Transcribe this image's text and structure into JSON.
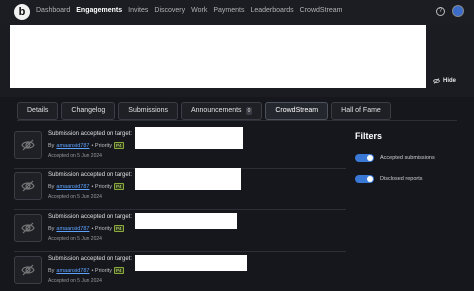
{
  "nav": {
    "logo": "b",
    "items": [
      "Dashboard",
      "Engagements",
      "Invites",
      "Discovery",
      "Work",
      "Payments",
      "Leaderboards",
      "CrowdStream"
    ],
    "active_index": 1,
    "help": "?"
  },
  "banner": {
    "hide_label": "Hide"
  },
  "tabs": {
    "details": "Details",
    "changelog": "Changelog",
    "submissions": "Submissions",
    "announcements": "Announcements",
    "announcements_count": "0",
    "crowdstream": "CrowdStream",
    "hall_of_fame": "Hall of Fame"
  },
  "feed": [
    {
      "title": "Submission accepted on target:",
      "by": "By",
      "user": "amaansid787",
      "priority_label": "• Priority",
      "priority": "P4",
      "date": "Accepted on 5 Jun 2024"
    },
    {
      "title": "Submission accepted on target:",
      "by": "By",
      "user": "amaansid787",
      "priority_label": "• Priority",
      "priority": "P4",
      "date": "Accepted on 5 Jun 2024"
    },
    {
      "title": "Submission accepted on target:",
      "by": "By",
      "user": "amaansid787",
      "priority_label": "• Priority",
      "priority": "P4",
      "date": "Accepted on 5 Jun 2024"
    },
    {
      "title": "Submission accepted on target:",
      "by": "By",
      "user": "amaansid787",
      "priority_label": "• Priority",
      "priority": "P4",
      "date": "Accepted on 5 Jun 2024"
    }
  ],
  "filters": {
    "title": "Filters",
    "accepted": "Accepted submissions",
    "disclosed": "Disclosed reports",
    "accepted_on": true,
    "disclosed_on": true
  },
  "colors": {
    "background": "#15171d",
    "toggle": "#3a78d6",
    "link": "#5ea2ff",
    "priority_badge": "#8aab3c"
  }
}
